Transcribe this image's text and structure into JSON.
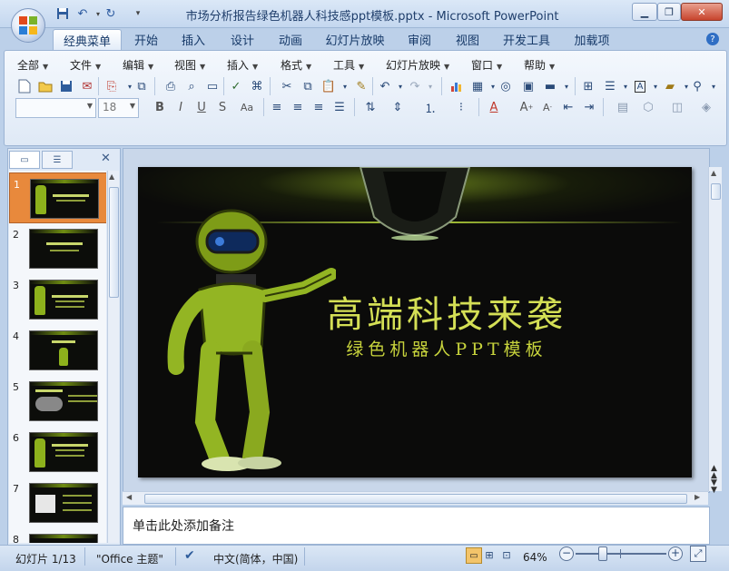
{
  "window": {
    "title": "市场分析报告绿色机器人科技感ppt模板.pptx - Microsoft PowerPoint",
    "minimize_icon": "minimize-icon",
    "maximize_icon": "maximize-icon",
    "close_icon": "close-icon"
  },
  "ribbon_tabs": [
    "经典菜单",
    "开始",
    "插入",
    "设计",
    "动画",
    "幻灯片放映",
    "审阅",
    "视图",
    "开发工具",
    "加载项"
  ],
  "active_tab": "经典菜单",
  "classic_menus": [
    "全部",
    "文件",
    "编辑",
    "视图",
    "插入",
    "格式",
    "工具",
    "幻灯片放映",
    "窗口",
    "帮助"
  ],
  "toolbar": {
    "font_name": "",
    "font_size": "18"
  },
  "slides": [
    "1",
    "2",
    "3",
    "4",
    "5",
    "6",
    "7",
    "8"
  ],
  "current_slide": {
    "title": "高端科技来袭",
    "subtitle": "绿色机器人PPT模板"
  },
  "notes": {
    "placeholder": "单击此处添加备注"
  },
  "status": {
    "slide_position": "幻灯片 1/13",
    "theme": "\"Office 主题\"",
    "language": "中文(简体，中国)",
    "zoom": "64%"
  },
  "colors": {
    "ribbon_bg": "#dfe9f6",
    "slide_bg": "#0b0b0a",
    "slide_accent": "#c7d33c",
    "selected_slide": "#e8893c"
  }
}
